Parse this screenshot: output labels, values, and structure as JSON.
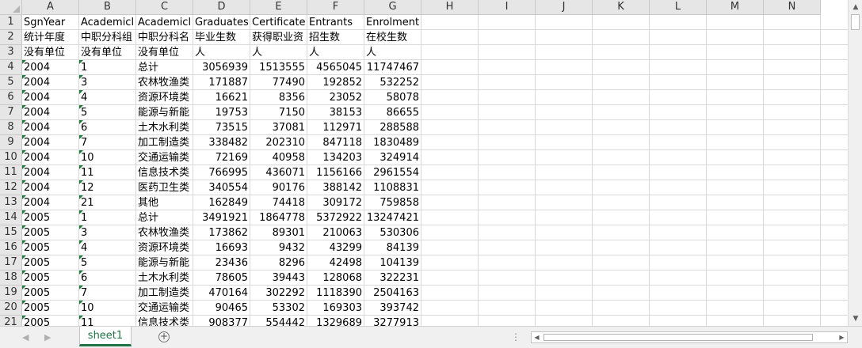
{
  "sheet": {
    "columns": [
      "A",
      "B",
      "C",
      "D",
      "E",
      "F",
      "G",
      "H",
      "I",
      "J",
      "K",
      "L",
      "M",
      "N"
    ],
    "rows_visible": [
      "1",
      "2",
      "3",
      "4",
      "5",
      "6",
      "7",
      "8",
      "9",
      "10",
      "11",
      "12",
      "13",
      "14",
      "15",
      "16",
      "17",
      "18",
      "19",
      "20",
      "21"
    ],
    "header_rows": [
      [
        "SgnYear",
        "Academicl",
        "Academicl",
        "Graduates",
        "Certificate",
        "Entrants",
        "Enrolment"
      ],
      [
        "统计年度",
        "中职分科组",
        "中职分科名",
        "毕业生数",
        "获得职业资",
        "招生数",
        "在校生数"
      ],
      [
        "没有单位",
        "没有单位",
        "没有单位",
        "人",
        "人",
        "人",
        "人"
      ]
    ],
    "data_rows": [
      [
        "2004",
        "1",
        "总计",
        "3056939",
        "1513555",
        "4565045",
        "11747467"
      ],
      [
        "2004",
        "3",
        "农林牧渔类",
        "171887",
        "77490",
        "192852",
        "532252"
      ],
      [
        "2004",
        "4",
        "资源环境类",
        "16621",
        "8356",
        "23052",
        "58078"
      ],
      [
        "2004",
        "5",
        "能源与新能",
        "19753",
        "7150",
        "38153",
        "86655"
      ],
      [
        "2004",
        "6",
        "土木水利类",
        "73515",
        "37081",
        "112971",
        "288588"
      ],
      [
        "2004",
        "7",
        "加工制造类",
        "338482",
        "202310",
        "847118",
        "1830489"
      ],
      [
        "2004",
        "10",
        "交通运输类",
        "72169",
        "40958",
        "134203",
        "324914"
      ],
      [
        "2004",
        "11",
        "信息技术类",
        "766995",
        "436071",
        "1156166",
        "2961554"
      ],
      [
        "2004",
        "12",
        "医药卫生类",
        "340554",
        "90176",
        "388142",
        "1108831"
      ],
      [
        "2004",
        "21",
        "其他",
        "162849",
        "74418",
        "309172",
        "759858"
      ],
      [
        "2005",
        "1",
        "总计",
        "3491921",
        "1864778",
        "5372922",
        "13247421"
      ],
      [
        "2005",
        "3",
        "农林牧渔类",
        "173862",
        "89301",
        "210063",
        "530306"
      ],
      [
        "2005",
        "4",
        "资源环境类",
        "16693",
        "9432",
        "43299",
        "84139"
      ],
      [
        "2005",
        "5",
        "能源与新能",
        "23436",
        "8296",
        "42498",
        "104139"
      ],
      [
        "2005",
        "6",
        "土木水利类",
        "78605",
        "39443",
        "128068",
        "322231"
      ],
      [
        "2005",
        "7",
        "加工制造类",
        "470164",
        "302292",
        "1118390",
        "2504163"
      ],
      [
        "2005",
        "10",
        "交通运输类",
        "90465",
        "53302",
        "169303",
        "393742"
      ],
      [
        "2005",
        "11",
        "信息技术类",
        "908377",
        "554442",
        "1329689",
        "3277913"
      ]
    ]
  },
  "tabs": {
    "active": "sheet1"
  },
  "colors": {
    "accent": "#217346",
    "header_bg": "#e6e6e6",
    "flag": "#1e7a3a"
  },
  "icons": {
    "add_sheet": "plus-circle-icon",
    "prev_sheet": "arrow-left-icon",
    "next_sheet": "arrow-right-icon"
  }
}
